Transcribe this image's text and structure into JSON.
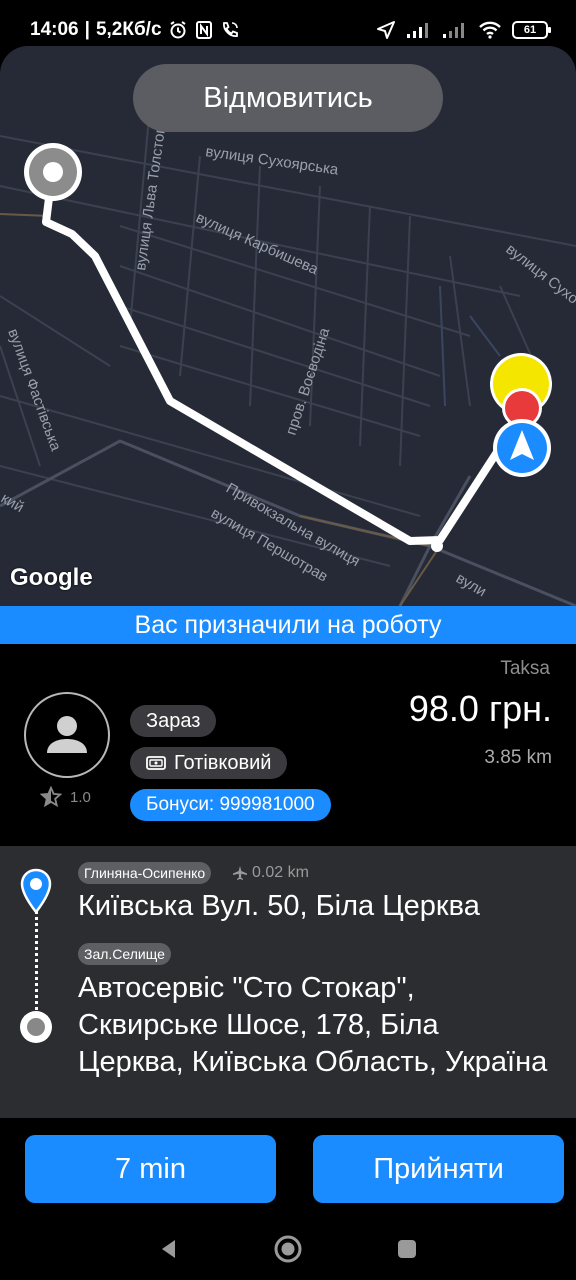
{
  "status_bar": {
    "time": "14:06",
    "speed": "5,2Кб/с",
    "battery": "61"
  },
  "map": {
    "decline_label": "Відмовитись",
    "google_label": "Google",
    "streets": [
      "вулиця Сухоярська",
      "вулиця Льва Толстого",
      "вулиця Карбишева",
      "вулиця Сухо",
      "пров. Воєводіна",
      "вулиця Фастівська",
      "Привокзальна вулиця",
      "вулиця Першотрав",
      "вули",
      "кий"
    ]
  },
  "banner": {
    "text": "Вас призначили на роботу"
  },
  "order": {
    "rating": "1.0",
    "when_chip": "Зараз",
    "payment_chip": "Готівковий",
    "bonus_chip": "Бонуси: 999981000",
    "tariff": "Taksa",
    "price": "98.0 грн.",
    "distance": "3.85 km"
  },
  "route": {
    "from_zone": "Глиняна-Осипенко",
    "from_distance": "0.02 km",
    "from_address": "Київська Вул. 50, Біла Церква",
    "to_zone": "Зал.Селище",
    "to_address": "Автосервіс \"Сто Стокар\", Сквирське Шосе, 178, Біла Церква, Київська Область, Україна"
  },
  "actions": {
    "time_label": "7 min",
    "accept_label": "Прийняти"
  },
  "colors": {
    "accent": "#1a8cff",
    "map_bg": "#252a36",
    "route_bg": "#2c2d31"
  }
}
